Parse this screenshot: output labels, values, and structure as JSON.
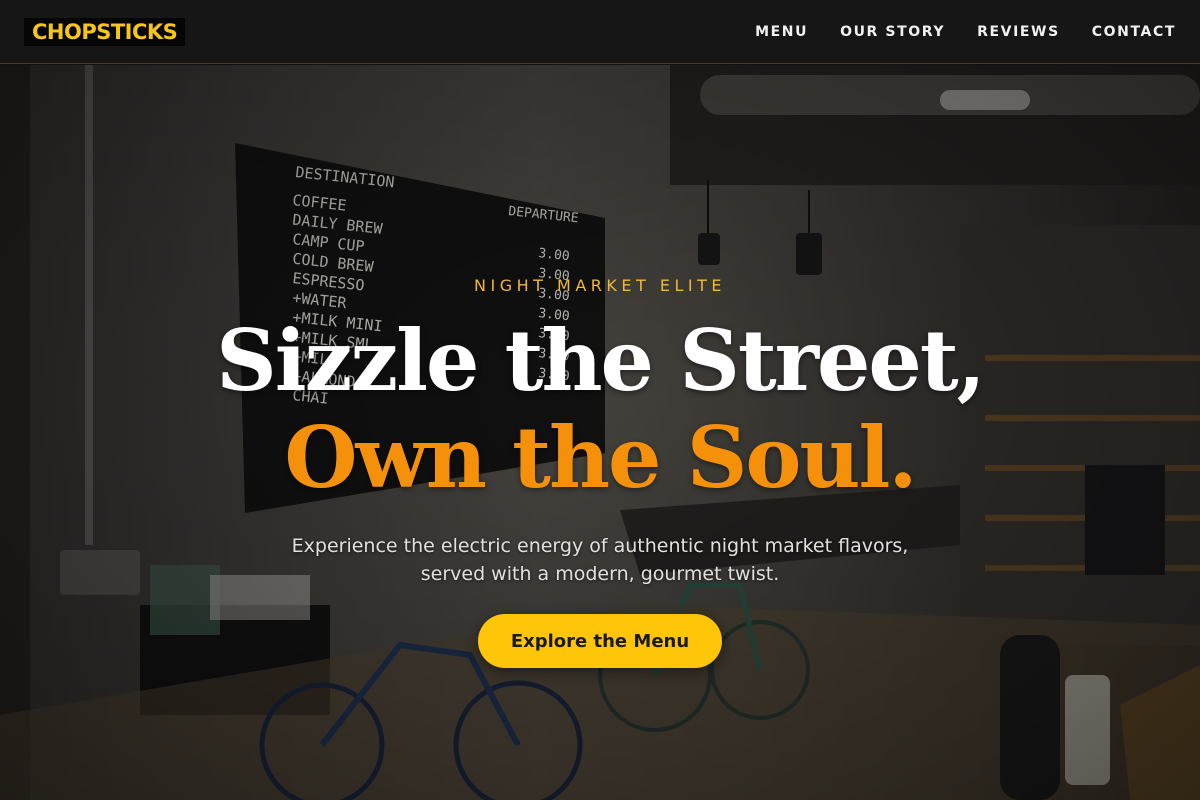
{
  "nav": {
    "logo": "CHOPSTICKS",
    "links": [
      "MENU",
      "OUR STORY",
      "REVIEWS",
      "CONTACT"
    ]
  },
  "hero": {
    "eyebrow": "NIGHT MARKET ELITE",
    "headline_line1": "Sizzle the Street,",
    "headline_line2": "Own the Soul.",
    "subtext": "Experience the electric energy of authentic night market flavors, served with a modern, gourmet twist.",
    "cta_label": "Explore the Menu",
    "background_image": "cafe-interior-photo",
    "menu_board": {
      "heading_left": "DESTINATION",
      "heading_right": "DEPARTURE",
      "items": [
        "COFFEE",
        "DAILY BREW",
        "CAMP CUP",
        "COLD BREW",
        "ESPRESSO",
        "+WATER",
        "+MILK MINI",
        "+MILK SML",
        "+MILK",
        "+ALMOND",
        "CHAI"
      ],
      "prices": [
        "3.00",
        "3.00",
        "3.00",
        "3.00",
        "3.00",
        "3.00",
        "3.00"
      ]
    }
  },
  "colors": {
    "brand_yellow": "#f5c518",
    "accent_orange": "#f5900a",
    "cta_yellow": "#ffc609",
    "nav_bg": "#161616"
  }
}
